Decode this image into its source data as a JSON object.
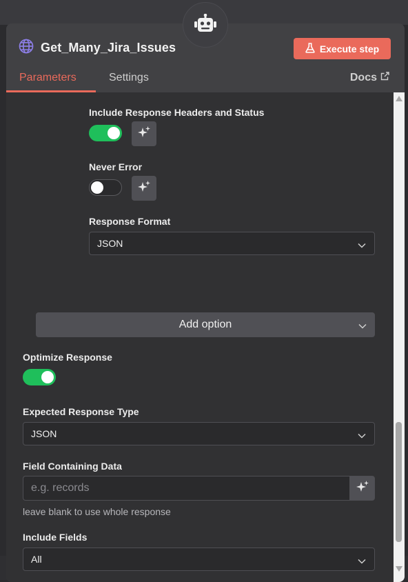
{
  "node": {
    "title": "Get_Many_Jira_Issues",
    "execute_label": "Execute step"
  },
  "tabs": {
    "parameters": "Parameters",
    "settings": "Settings",
    "docs": "Docs"
  },
  "options": {
    "include_headers": {
      "label": "Include Response Headers and Status",
      "enabled": true
    },
    "never_error": {
      "label": "Never Error",
      "enabled": false
    },
    "response_format": {
      "label": "Response Format",
      "value": "JSON"
    },
    "add_option_label": "Add option"
  },
  "fields": {
    "optimize_response": {
      "label": "Optimize Response",
      "enabled": true
    },
    "expected_response_type": {
      "label": "Expected Response Type",
      "value": "JSON"
    },
    "field_containing_data": {
      "label": "Field Containing Data",
      "placeholder": "e.g. records",
      "value": "",
      "hint": "leave blank to use whole response"
    },
    "include_fields": {
      "label": "Include Fields",
      "value": "All"
    }
  },
  "colors": {
    "accent": "#ea6a5b",
    "toggle_on": "#1fbf5b",
    "panel_bg": "#414144",
    "content_bg": "#313133"
  },
  "icons": {
    "robot": "robot-icon",
    "globe": "globe-icon",
    "flask": "flask-icon",
    "external_link": "external-link-icon",
    "ai_sparkle": "sparkle-icon",
    "chevron": "chevron-down-icon"
  }
}
